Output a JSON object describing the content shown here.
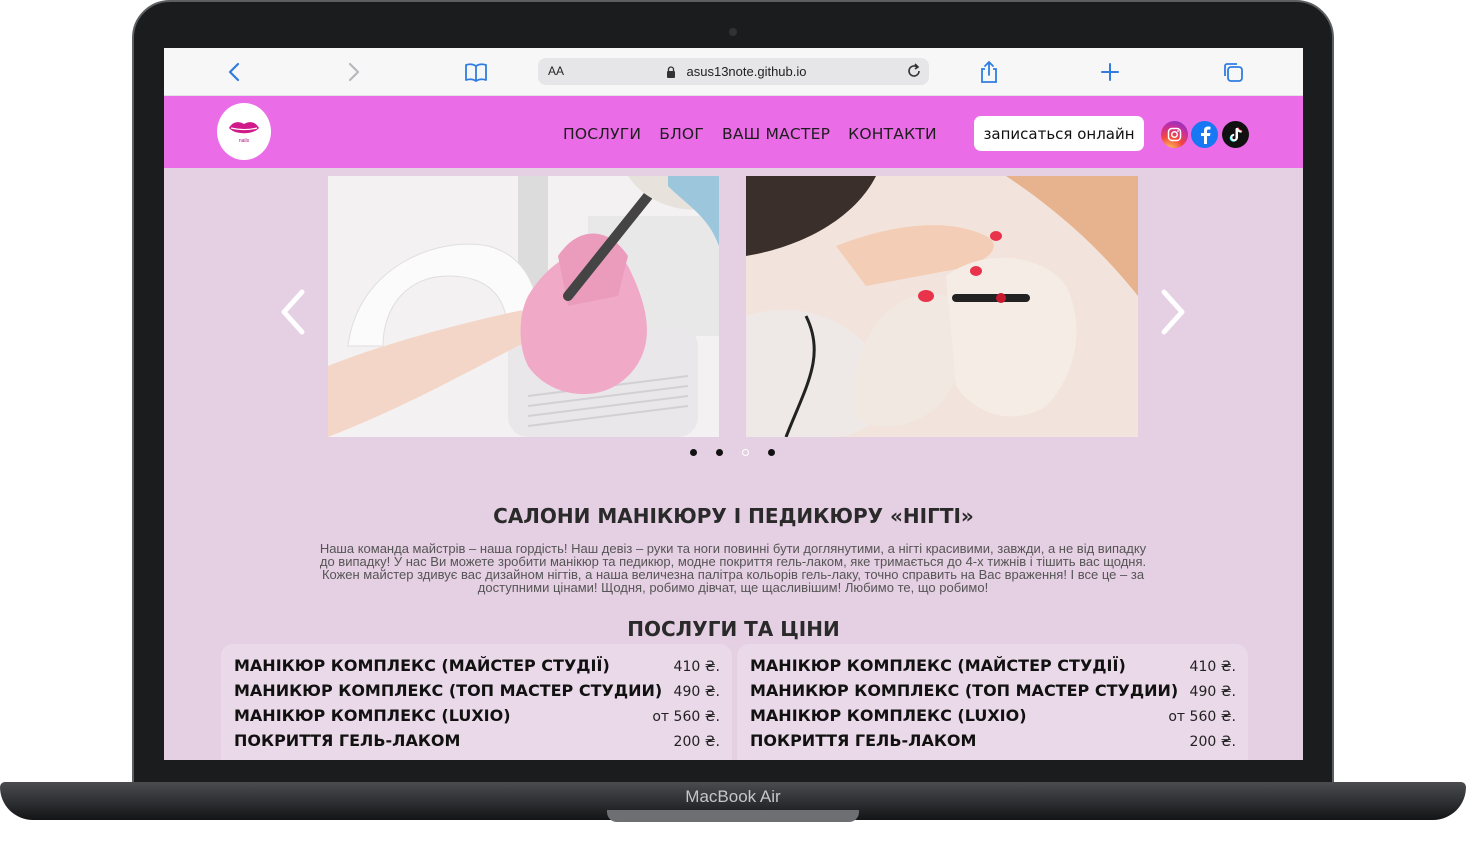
{
  "browser": {
    "text_size_label": "AA",
    "url": "asus13note.github.io"
  },
  "site": {
    "logo_text": "nails",
    "nav": [
      "ПОСЛУГИ",
      "БЛОГ",
      "ВАШ МАСТЕР",
      "КОНТАКТИ"
    ],
    "cta_label": "записаться онлайн"
  },
  "carousel": {
    "active_dot": 3,
    "dot_count": 4
  },
  "about": {
    "title": "САЛОНИ МАНІКЮРУ І ПЕДИКЮРУ «НІГТІ»",
    "lines": [
      "Наша команда майстрів – наша гордість! Наш девіз – руки та ноги повинні бути доглянутими, а нігті красивими, завжди, а не від випадку",
      "до випадку! У нас Ви можете зробити манікюр та педикюр, модне покриття гель-лаком, яке тримається до 4-х тижнів і тішить вас щодня.",
      "Кожен майстер здивує вас дизайном нігтів, а наша величезна палітра кольорів гель-лаку, точно справить на Вас враження! І все це – за",
      "доступними цінами! Щодня, робимо дівчат, ще щасливішим! Любимо те, що робимо!"
    ]
  },
  "prices": {
    "title": "ПОСЛУГИ ТА ЦІНИ",
    "left": [
      {
        "name": "МАНІКЮР КОМПЛЕКС (МАЙСТЕР СТУДІЇ)",
        "price": "410 ₴."
      },
      {
        "name": "МАНИКЮР КОМПЛЕКС (ТОП МАСТЕР СТУДИИ)",
        "price": "490 ₴."
      },
      {
        "name": "МАНІКЮР КОМПЛЕКС (LUXIO)",
        "price": "от 560 ₴."
      },
      {
        "name": "ПОКРИТТЯ ГЕЛЬ-ЛАКОМ",
        "price": "200 ₴."
      }
    ],
    "right": [
      {
        "name": "МАНІКЮР КОМПЛЕКС (МАЙСТЕР СТУДІЇ)",
        "price": "410 ₴."
      },
      {
        "name": "МАНИКЮР КОМПЛЕКС (ТОП МАСТЕР СТУДИИ)",
        "price": "490 ₴."
      },
      {
        "name": "МАНІКЮР КОМПЛЕКС (LUXIO)",
        "price": "от 560 ₴."
      },
      {
        "name": "ПОКРИТТЯ ГЕЛЬ-ЛАКОМ",
        "price": "200 ₴."
      }
    ]
  },
  "device": {
    "model": "MacBook Air"
  },
  "colors": {
    "header_bg": "#ea6ce7",
    "page_bg": "#e5cfe3",
    "card_bg": "#ead9e8",
    "browser_accent": "#2f7de1"
  },
  "icons": {
    "toolbar": [
      "chevron-left-icon",
      "chevron-right-icon",
      "bookmarks-icon",
      "lock-icon",
      "reload-icon",
      "share-icon",
      "plus-icon",
      "tabs-icon"
    ],
    "social": [
      "instagram-icon",
      "facebook-icon",
      "tiktok-icon"
    ]
  }
}
